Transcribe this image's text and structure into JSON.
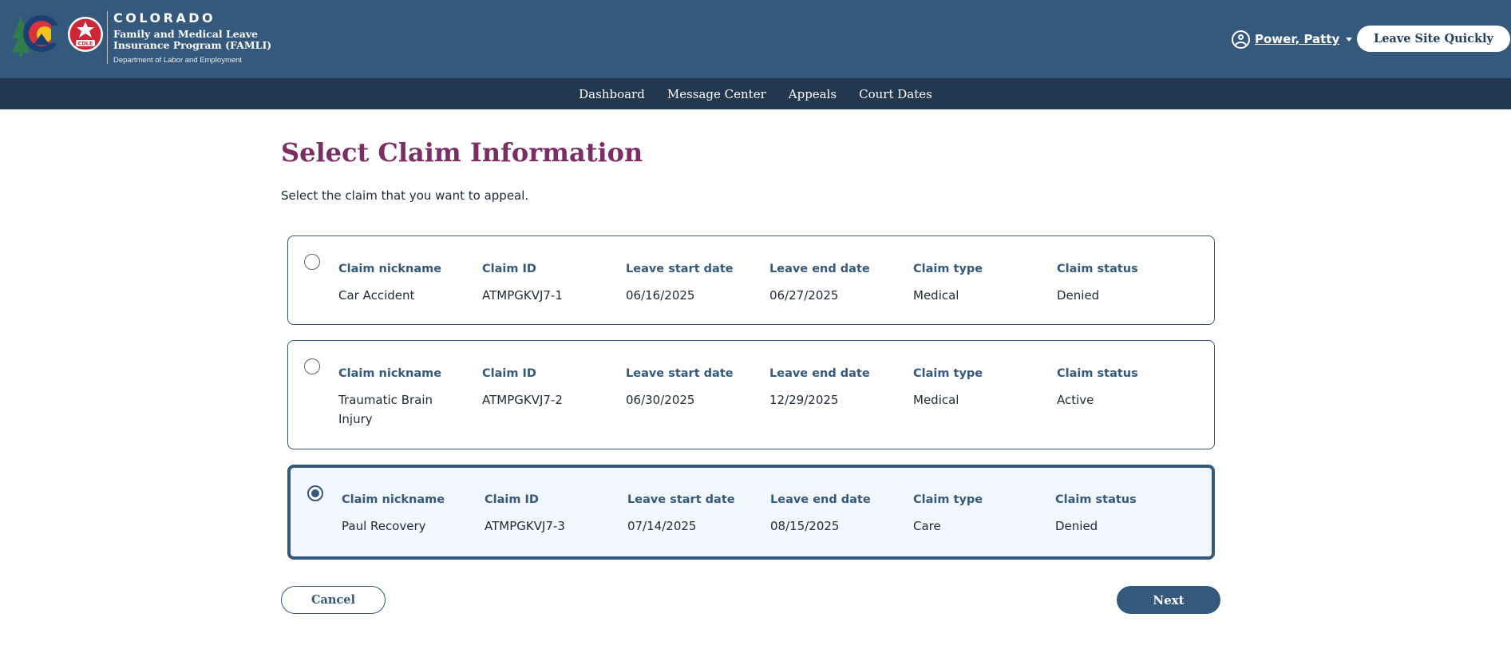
{
  "header": {
    "logo": {
      "state": "COLORADO",
      "program_line1": "Family and Medical Leave",
      "program_line2": "Insurance Program (FAMLI)",
      "department": "Department of Labor and Employment",
      "badge_text": "CDLE",
      "icon": "colorado-logo-icon"
    },
    "user": {
      "name": "Power, Patty",
      "icon": "user-circle-icon"
    },
    "leave_site_label": "Leave Site Quickly"
  },
  "nav": {
    "items": [
      {
        "label": "Dashboard"
      },
      {
        "label": "Message Center"
      },
      {
        "label": "Appeals"
      },
      {
        "label": "Court Dates"
      }
    ]
  },
  "main": {
    "title": "Select Claim Information",
    "instruction": "Select the claim that you want to appeal.",
    "columns": [
      "Claim nickname",
      "Claim ID",
      "Leave start date",
      "Leave end date",
      "Claim type",
      "Claim status"
    ],
    "claims": [
      {
        "nickname": "Car Accident",
        "id": "ATMPGKVJ7-1",
        "start": "06/16/2025",
        "end": "06/27/2025",
        "type": "Medical",
        "status": "Denied",
        "selected": false
      },
      {
        "nickname": "Traumatic Brain Injury",
        "id": "ATMPGKVJ7-2",
        "start": "06/30/2025",
        "end": "12/29/2025",
        "type": "Medical",
        "status": "Active",
        "selected": false
      },
      {
        "nickname": "Paul Recovery",
        "id": "ATMPGKVJ7-3",
        "start": "07/14/2025",
        "end": "08/15/2025",
        "type": "Care",
        "status": "Denied",
        "selected": true
      }
    ],
    "cancel_label": "Cancel",
    "next_label": "Next"
  },
  "colors": {
    "header_bg": "#35597c",
    "nav_bg": "#23374e",
    "title": "#7c2d66",
    "accent": "#35597c"
  }
}
